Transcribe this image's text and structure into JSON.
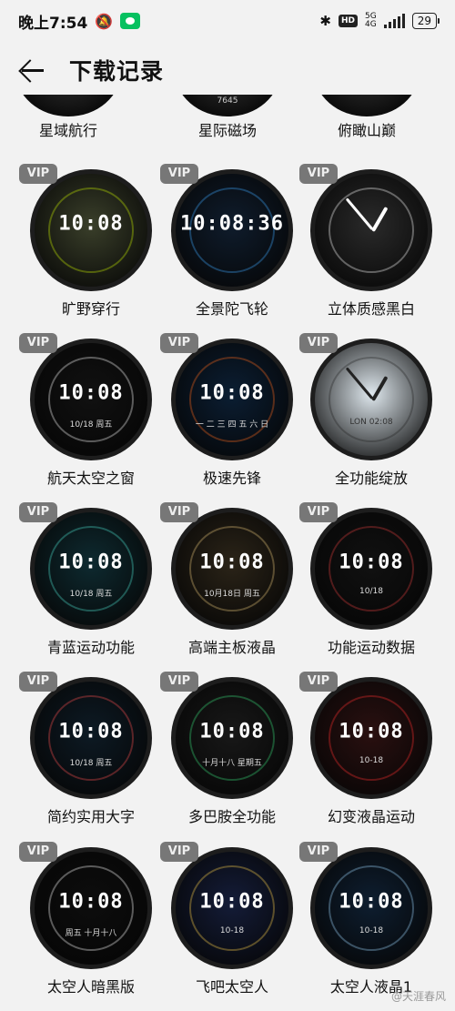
{
  "status_bar": {
    "time": "晚上7:54",
    "network": "5G",
    "network_sub": "4G",
    "hd": "HD",
    "battery": "29"
  },
  "header": {
    "title": "下载记录"
  },
  "partial_row": [
    {
      "label": "星域航行",
      "num": ""
    },
    {
      "label": "星际磁场",
      "num": "7645"
    },
    {
      "label": "俯瞰山巅",
      "num": ""
    }
  ],
  "vip_label": "VIP",
  "watch_faces": [
    {
      "label": "旷野穿行",
      "clock": "10:08",
      "date": "",
      "theme": "#3a3f2a",
      "accent": "#c8f000",
      "analog": false
    },
    {
      "label": "全景陀飞轮",
      "clock": "10:08:36",
      "date": "",
      "theme": "#0f1c2c",
      "accent": "#3fa7ff",
      "analog": false
    },
    {
      "label": "立体质感黑白",
      "clock": "",
      "date": "",
      "theme": "#2a2a2a",
      "accent": "#ffffff",
      "analog": true
    },
    {
      "label": "航天太空之窗",
      "clock": "10:08",
      "date": "10/18 周五",
      "theme": "#111111",
      "accent": "#ffffff",
      "analog": false
    },
    {
      "label": "极速先锋",
      "clock": "10:08",
      "date": "一 二 三 四 五 六 日",
      "theme": "#0b1e33",
      "accent": "#ff6a1a",
      "analog": false
    },
    {
      "label": "全功能绽放",
      "clock": "",
      "date": "LON 02:08",
      "theme": "#dfe8ee",
      "accent": "#222222",
      "analog": true
    },
    {
      "label": "青蓝运动功能",
      "clock": "10:08",
      "date": "10/18 周五",
      "theme": "#0e2a30",
      "accent": "#4de0d0",
      "analog": false
    },
    {
      "label": "高端主板液晶",
      "clock": "10:08",
      "date": "10月18日 周五",
      "theme": "#2b2418",
      "accent": "#e8c77a",
      "analog": false
    },
    {
      "label": "功能运动数据",
      "clock": "10:08",
      "date": "10/18",
      "theme": "#111111",
      "accent": "#e04040",
      "analog": false
    },
    {
      "label": "简约实用大字",
      "clock": "10:08",
      "date": "10/18 周五",
      "theme": "#0d1a24",
      "accent": "#ff5050",
      "analog": false
    },
    {
      "label": "多巴胺全功能",
      "clock": "10:08",
      "date": "十月十八 星期五",
      "theme": "#181818",
      "accent": "#3adf7a",
      "analog": false
    },
    {
      "label": "幻变液晶运动",
      "clock": "10:08",
      "date": "10-18",
      "theme": "#2a1010",
      "accent": "#ff3030",
      "analog": false
    },
    {
      "label": "太空人暗黑版",
      "clock": "10:08",
      "date": "周五 十月十八",
      "theme": "#0d0d0d",
      "accent": "#ffffff",
      "analog": false
    },
    {
      "label": "飞吧太空人",
      "clock": "10:08",
      "date": "10-18",
      "theme": "#141c38",
      "accent": "#ffd24a",
      "analog": false
    },
    {
      "label": "太空人液晶1",
      "clock": "10:08",
      "date": "10-18",
      "theme": "#0e1e30",
      "accent": "#9fd8ff",
      "analog": false
    }
  ],
  "watermark": "@天涯春风"
}
